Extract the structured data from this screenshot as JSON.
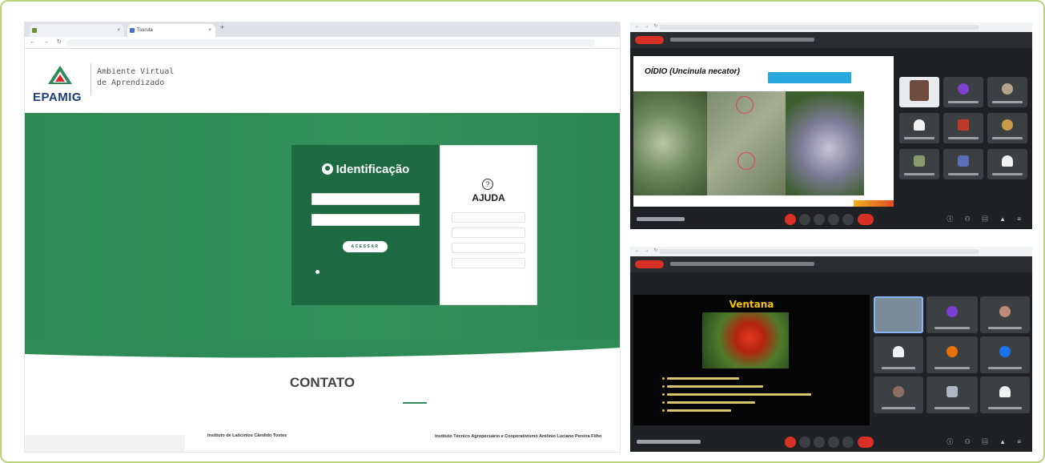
{
  "colors": {
    "frame_border": "#b9d37a",
    "brand_green": "#2e8b57",
    "login_green": "#1f6b41",
    "meet_bg": "#202124",
    "meet_red": "#d93025",
    "ventana_yellow": "#f2c200"
  },
  "left_page": {
    "tabs": [
      {
        "label": "Tsuruta"
      }
    ],
    "logo": {
      "text": "EPAMIG",
      "icon": "epamig-triangle-logo"
    },
    "site_title": {
      "line1": "Ambiente Virtual",
      "line2": "de Aprendizado"
    },
    "login": {
      "title": "Identificação",
      "icon": "user-circle-icon",
      "submit_label": "ACESSAR"
    },
    "help": {
      "icon": "question-circle-icon",
      "title": "AJUDA"
    },
    "contact": {
      "title": "CONTATO",
      "col1_title": "Instituto de Laticínios Cândido Tostes",
      "col2_title": "Instituto Técnico Agropecuário e Cooperativismo Antônio Luciano Pereira Filho"
    }
  },
  "meet1": {
    "slide_title": "OÍDIO (Uncinula necator)"
  },
  "meet2": {
    "slide_title": "Ventana"
  }
}
